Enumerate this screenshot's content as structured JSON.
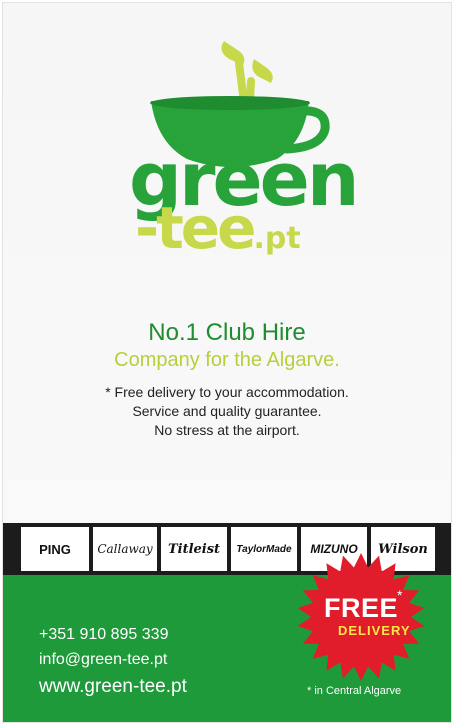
{
  "logo": {
    "word_green": "green",
    "word_tee": "-tee",
    "word_pt": ".pt"
  },
  "headline": {
    "line1": "No.1 Club Hire",
    "line2": "Company for the Algarve."
  },
  "features": [
    "* Free delivery to your accommodation.",
    "Service and quality guarantee.",
    "No stress at the airport."
  ],
  "brands": [
    "PING",
    "Callaway",
    "Titleist",
    "TaylorMade",
    "MIZUNO",
    "Wilson"
  ],
  "contact": {
    "phone": "+351 910 895 339",
    "email": "info@green-tee.pt",
    "website": "www.green-tee.pt"
  },
  "badge": {
    "free": "FREE",
    "asterisk": "*",
    "delivery": "DELIVERY",
    "footnote": "* in Central Algarve"
  },
  "colors": {
    "brand_green": "#27a33a",
    "lime": "#c7d84a",
    "badge_red": "#e21d2b",
    "band_dark": "#1c1c1c"
  }
}
